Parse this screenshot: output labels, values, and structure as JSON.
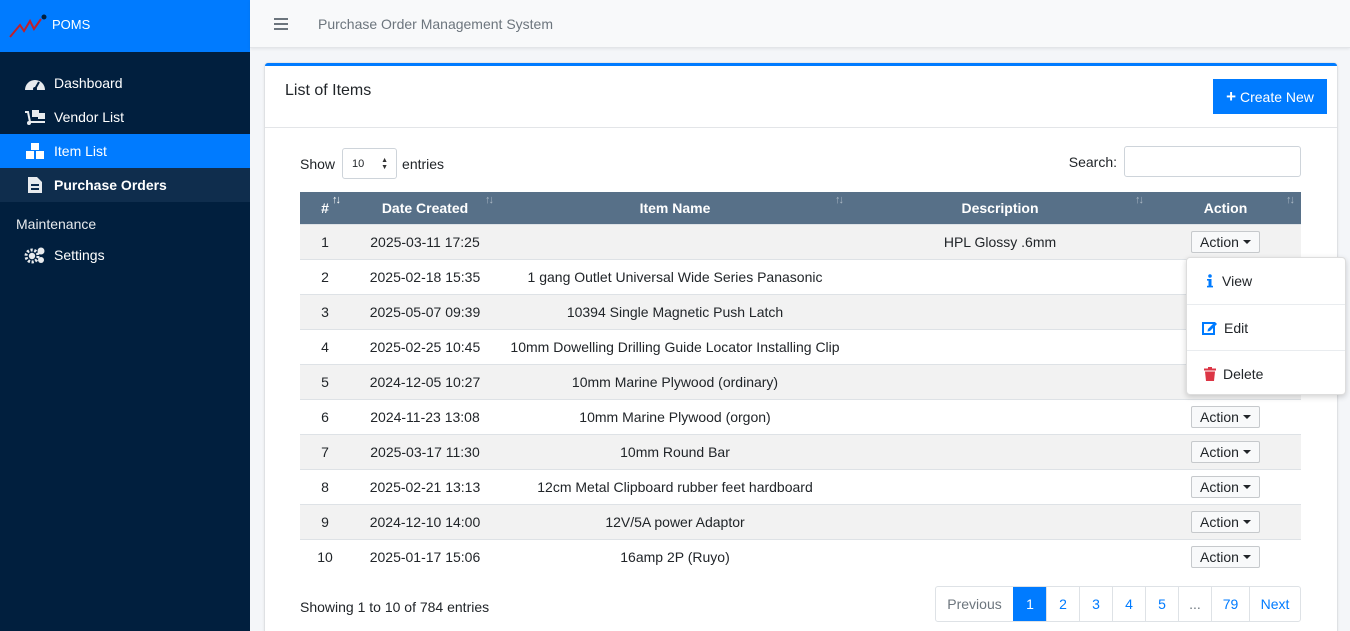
{
  "brand": {
    "name": "POMS"
  },
  "sidebar": {
    "items": [
      {
        "label": "Dashboard",
        "icon": "tachometer-icon"
      },
      {
        "label": "Vendor List",
        "icon": "truck-loading-icon"
      },
      {
        "label": "Item List",
        "icon": "boxes-icon"
      },
      {
        "label": "Purchase Orders",
        "icon": "file-invoice-icon"
      }
    ],
    "section": "Maintenance",
    "settings": {
      "label": "Settings",
      "icon": "cogs-icon"
    }
  },
  "topbar": {
    "title": "Purchase Order Management System",
    "menu_icon": "bars-icon"
  },
  "card": {
    "title": "List of Items",
    "create_label": "Create New",
    "show_label": "Show",
    "entries_label": "entries",
    "page_size": "10",
    "search_label": "Search:"
  },
  "table": {
    "columns": [
      "#",
      "Date Created",
      "Item Name",
      "Description",
      "Action"
    ],
    "action_label": "Action",
    "rows": [
      {
        "num": "1",
        "date": "2025-03-11 17:25",
        "name": "",
        "desc": "HPL Glossy .6mm"
      },
      {
        "num": "2",
        "date": "2025-02-18 15:35",
        "name": "1 gang Outlet Universal Wide Series Panasonic",
        "desc": ""
      },
      {
        "num": "3",
        "date": "2025-05-07 09:39",
        "name": "10394 Single Magnetic Push Latch",
        "desc": ""
      },
      {
        "num": "4",
        "date": "2025-02-25 10:45",
        "name": "10mm Dowelling Drilling Guide Locator Installing Clip",
        "desc": ""
      },
      {
        "num": "5",
        "date": "2024-12-05 10:27",
        "name": "10mm Marine Plywood (ordinary)",
        "desc": ""
      },
      {
        "num": "6",
        "date": "2024-11-23 13:08",
        "name": "10mm Marine Plywood (orgon)",
        "desc": ""
      },
      {
        "num": "7",
        "date": "2025-03-17 11:30",
        "name": "10mm Round Bar",
        "desc": ""
      },
      {
        "num": "8",
        "date": "2025-02-21 13:13",
        "name": "12cm Metal Clipboard rubber feet hardboard",
        "desc": ""
      },
      {
        "num": "9",
        "date": "2024-12-10 14:00",
        "name": "12V/5A power Adaptor",
        "desc": ""
      },
      {
        "num": "10",
        "date": "2025-01-17 15:06",
        "name": "16amp 2P (Ruyo)",
        "desc": ""
      }
    ]
  },
  "dropdown": {
    "items": [
      {
        "label": "View",
        "icon": "info-icon",
        "color": "#007bff"
      },
      {
        "label": "Edit",
        "icon": "edit-icon",
        "color": "#007bff"
      },
      {
        "label": "Delete",
        "icon": "trash-icon",
        "color": "#dc3545"
      }
    ]
  },
  "footer": {
    "info": "Showing 1 to 10 of 784 entries",
    "pages": [
      "Previous",
      "1",
      "2",
      "3",
      "4",
      "5",
      "...",
      "79",
      "Next"
    ]
  },
  "colors": {
    "primary": "#007bff",
    "sidebar": "#011f3e",
    "table_header": "#577088"
  }
}
